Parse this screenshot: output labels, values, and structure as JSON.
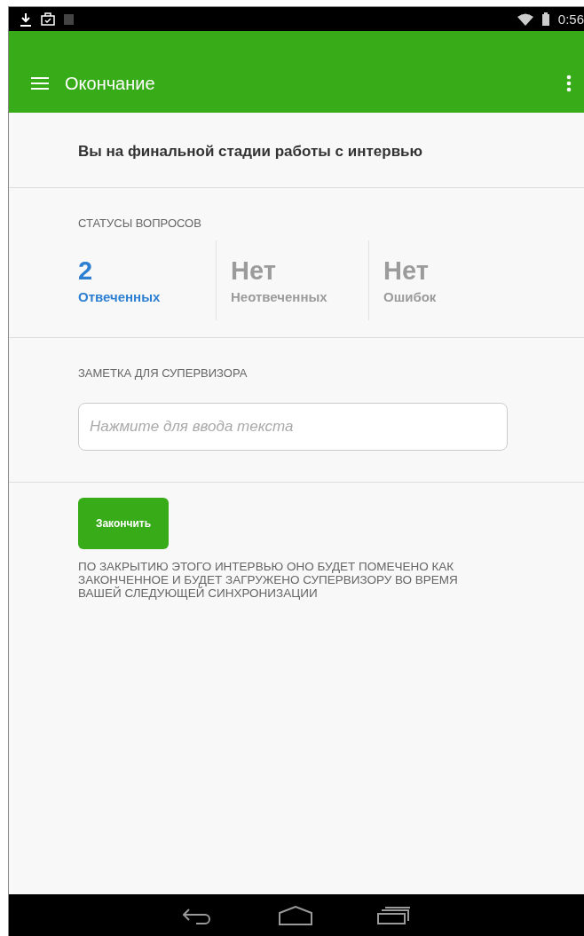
{
  "status_bar": {
    "time": "0:56"
  },
  "app_bar": {
    "title": "Окончание"
  },
  "heading": "Вы на финальной стадии работы с интервью",
  "question_statuses": {
    "label": "СТАТУСЫ ВОПРОСОВ",
    "items": [
      {
        "value": "2",
        "caption": "Отвеченных",
        "active": true
      },
      {
        "value": "Нет",
        "caption": "Неотвеченных",
        "active": false
      },
      {
        "value": "Нет",
        "caption": "Ошибок",
        "active": false
      }
    ]
  },
  "supervisor_note": {
    "label": "ЗАМЕТКА ДЛЯ СУПЕРВИЗОРА",
    "placeholder": "Нажмите для ввода текста"
  },
  "finish_button": "Закончить",
  "finish_notice": "ПО ЗАКРЫТИЮ ЭТОГО ИНТЕРВЬЮ ОНО БУДЕТ ПОМЕЧЕНО КАК ЗАКОНЧЕННОЕ И БУДЕТ ЗАГРУЖЕНО СУПЕРВИЗОРУ ВО ВРЕМЯ ВАШЕЙ СЛЕДУЮЩЕЙ СИНХРОНИЗАЦИИ"
}
